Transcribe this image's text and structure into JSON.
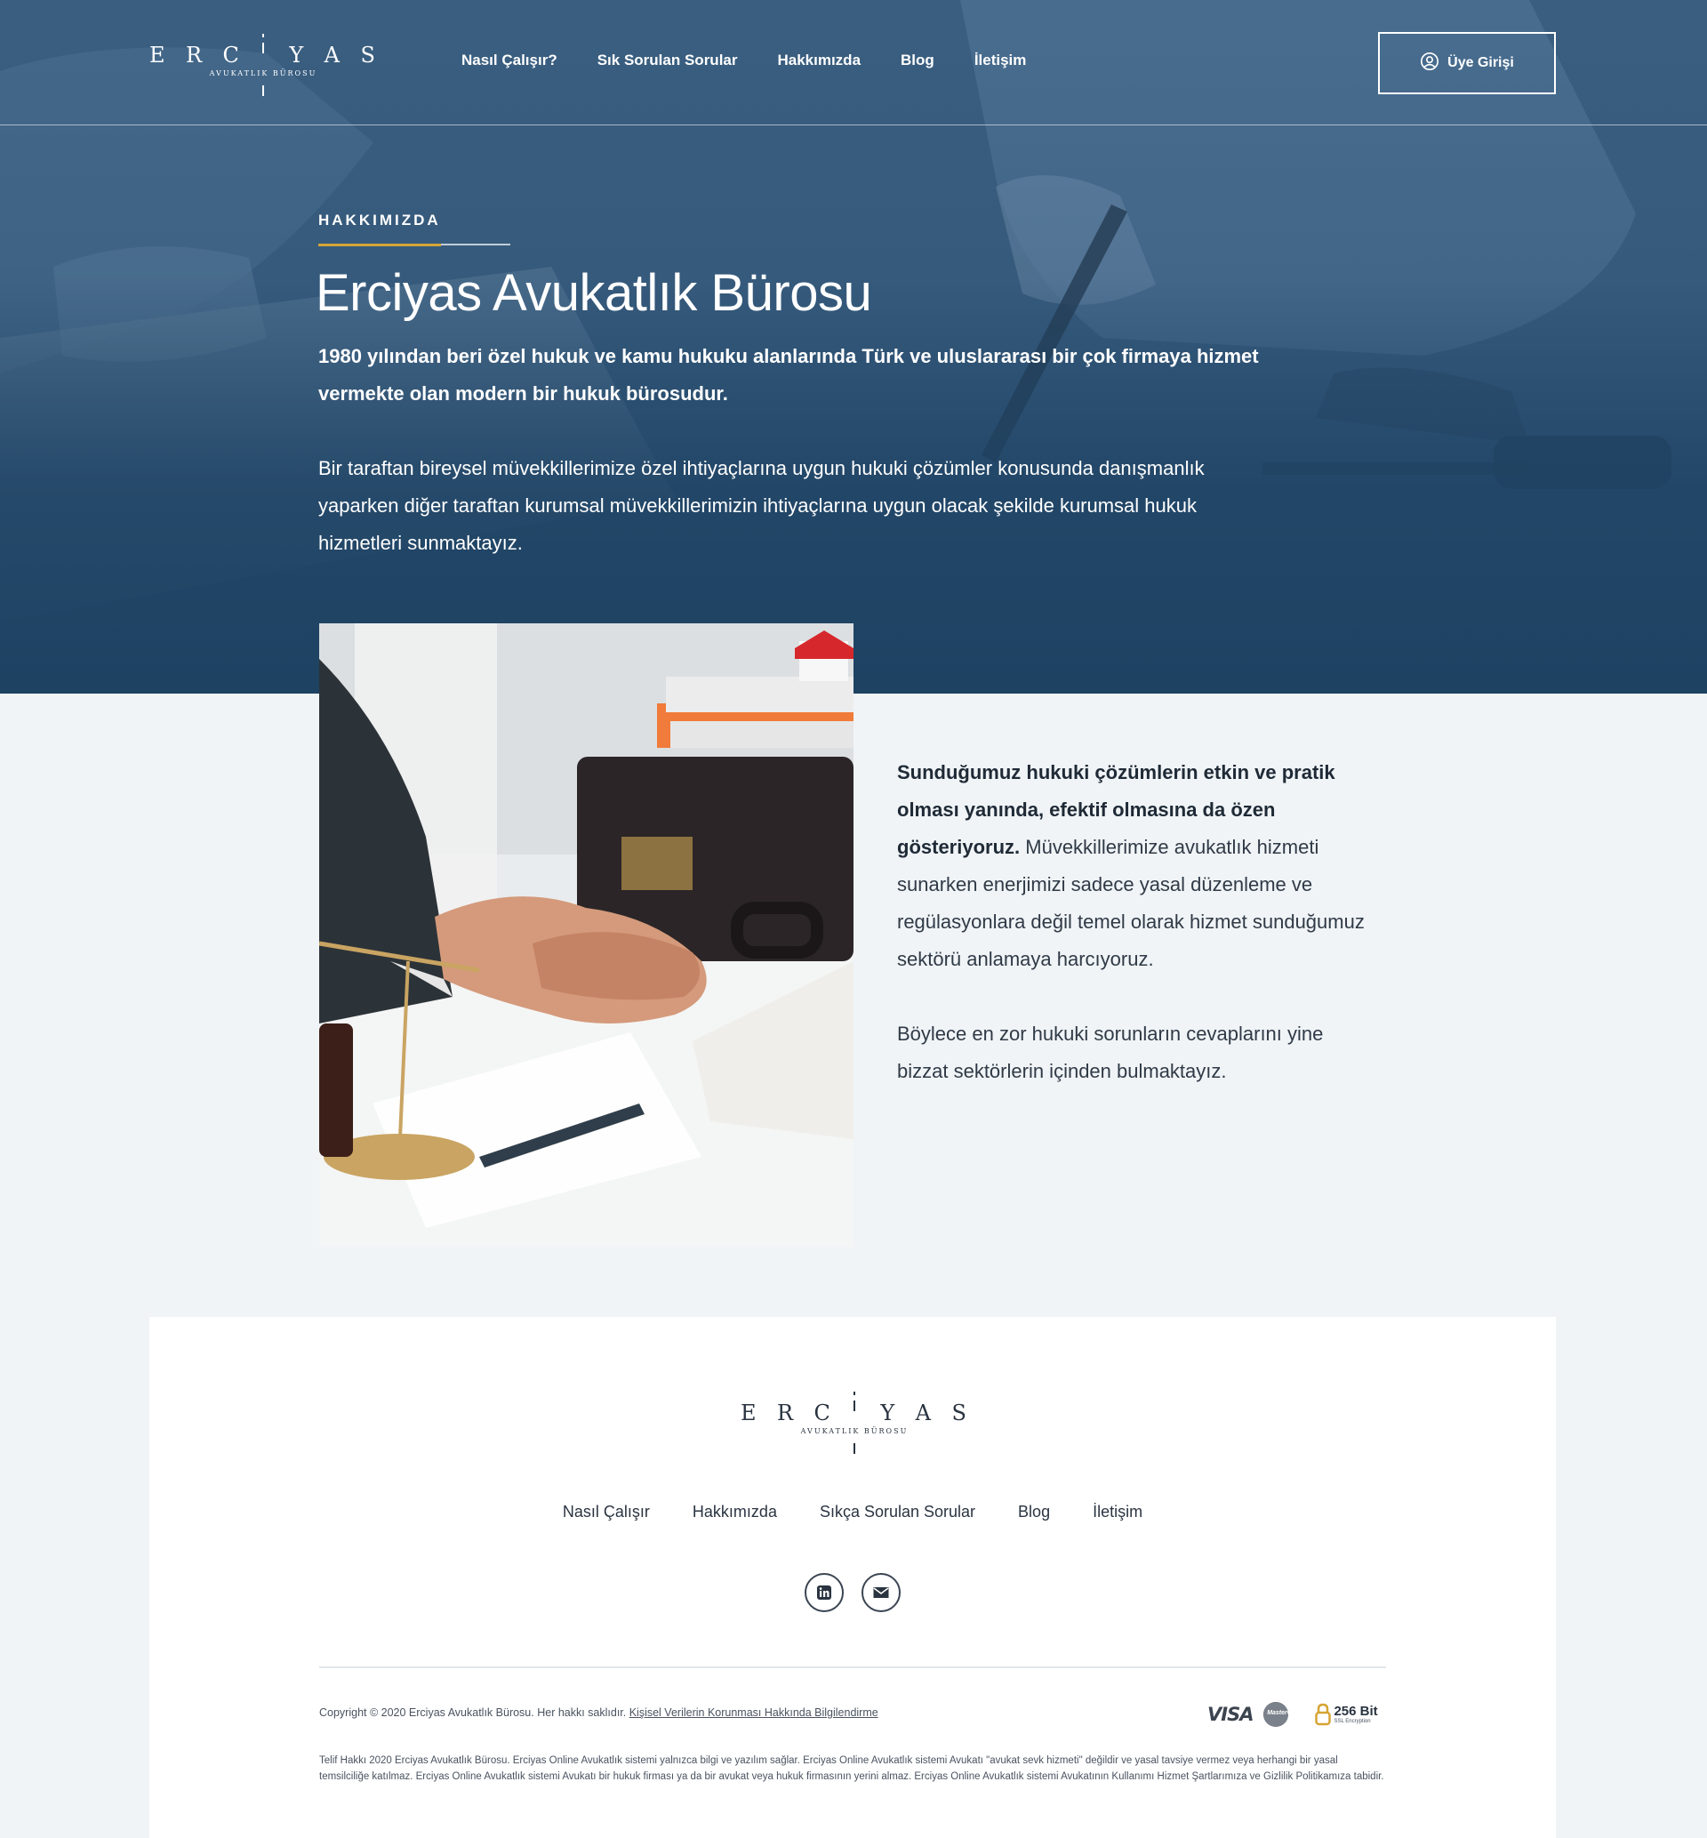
{
  "brand": {
    "letters": [
      "E",
      "R",
      "C",
      "İ",
      "Y",
      "A",
      "S"
    ],
    "subtitle": "AVUKATLIK BÜROSU"
  },
  "nav": {
    "items": [
      {
        "label": "Nasıl Çalışır?"
      },
      {
        "label": "Sık Sorulan Sorular"
      },
      {
        "label": "Hakkımızda"
      },
      {
        "label": "Blog"
      },
      {
        "label": "İletişim"
      }
    ],
    "login_label": "Üye Girişi"
  },
  "hero": {
    "eyebrow": "HAKKIMIZDA",
    "title": "Erciyas Avukatlık Bürosu",
    "lead": "1980 yılından beri özel hukuk ve kamu hukuku alanlarında Türk ve uluslararası bir çok firmaya hizmet vermekte olan modern bir hukuk bürosudur.",
    "body": "Bir taraftan bireysel müvekkillerimize özel ihtiyaçlarına uygun hukuki çözümler konusunda danışmanlık yaparken diğer taraftan kurumsal müvekkillerimizin ihtiyaçlarına uygun olacak şekilde kurumsal hukuk hizmetleri sunmaktayız."
  },
  "about": {
    "strong": "Sunduğumuz hukuki çözümlerin etkin ve pratik olması yanında, efektif olmasına da özen gösteriyoruz.",
    "text": " Müvekkillerimize avukatlık hizmeti sunarken enerjimizi sadece yasal düzenleme ve regülasyonlara değil temel olarak hizmet sunduğumuz sektörü anlamaya harcıyoruz.",
    "second": "Böylece en zor hukuki sorunların cevaplarını yine bizzat sektörlerin içinden bulmaktayız."
  },
  "footer": {
    "nav": [
      {
        "label": "Nasıl Çalışır"
      },
      {
        "label": "Hakkımızda"
      },
      {
        "label": "Sıkça Sorulan Sorular"
      },
      {
        "label": "Blog"
      },
      {
        "label": "İletişim"
      }
    ],
    "social": [
      {
        "icon": "linkedin-icon"
      },
      {
        "icon": "mail-icon"
      }
    ],
    "copyright": "Copyright © 2020 Erciyas Avukatlık Bürosu. Her hakkı saklıdır. ",
    "privacy_link": "Kişisel Verilerin Korunması Hakkında Bilgilendirme",
    "badges": {
      "visa": "VISA",
      "mastercard": "MasterCard",
      "ssl_title": "256 Bit",
      "ssl_sub": "SSL Encryption"
    },
    "legal": "Telif Hakkı 2020 Erciyas Avukatlık Bürosu. Erciyas Online Avukatlık sistemi yalnızca bilgi ve yazılım sağlar. Erciyas Online Avukatlık sistemi Avukatı \"avukat sevk hizmeti\" değildir ve yasal tavsiye vermez veya herhangi bir yasal temsilciliğe katılmaz. Erciyas Online Avukatlık sistemi Avukatı bir hukuk firması ya da bir avukat veya hukuk firmasının yerini almaz. Erciyas Online Avukatlık sistemi Avukatının Kullanımı Hizmet Şartlarımıza ve Gizlilik Politikamıza tabidir."
  },
  "colors": {
    "hero_blue": "#1e4263",
    "accent_gold": "#d6a434",
    "page_bg": "#f0f4f7",
    "text_dark": "#2a3441"
  }
}
